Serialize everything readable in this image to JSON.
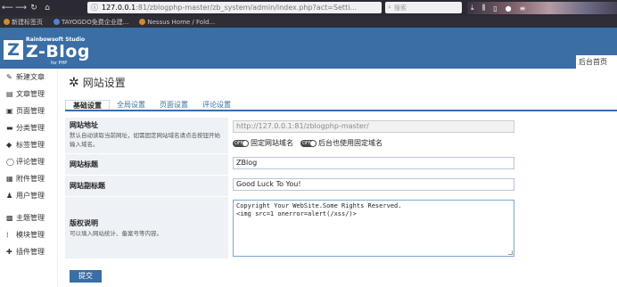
{
  "browser": {
    "url_host": "127.0.0.1",
    "url_path": ":81/zblogphp-master/zb_system/admin/index.php?act=Setti...",
    "search_placeholder": "搜索",
    "bookmarks": [
      "新建标签页",
      "TAYOGDO免费企业建...",
      "Nessus Home / Fold..."
    ]
  },
  "header": {
    "logo_letter": "Z",
    "logo_studio": "Rainbowsoft Studio",
    "logo_name": "Z-Blog",
    "logo_sub": "for PHP",
    "home_tab": "后台首页"
  },
  "sidebar": {
    "items": [
      {
        "label": "新建文章",
        "icon": "✎"
      },
      {
        "label": "文章管理",
        "icon": "▤"
      },
      {
        "label": "页面管理",
        "icon": "▣"
      },
      {
        "label": "分类管理",
        "icon": "▬"
      },
      {
        "label": "标签管理",
        "icon": "◆"
      },
      {
        "label": "评论管理",
        "icon": "◯"
      },
      {
        "label": "附件管理",
        "icon": "▦"
      },
      {
        "label": "用户管理",
        "icon": "♟"
      },
      {
        "label": "主题管理",
        "icon": "▩"
      },
      {
        "label": "模块管理",
        "icon": "⁞"
      },
      {
        "label": "插件管理",
        "icon": "✚"
      }
    ]
  },
  "main": {
    "title": "网站设置",
    "tabs": [
      "基础设置",
      "全局设置",
      "页面设置",
      "评论设置"
    ],
    "active_tab": 0,
    "site_url": {
      "label": "网站地址",
      "desc": "默认自动读取当前网址，如需固定网站域名请点击按钮开始输入域名。",
      "value": "http://127.0.0.1:81/zblogphp-master/",
      "toggle_label": "OFF",
      "toggle1_text": "固定网站域名",
      "toggle2_text": "后台也使用固定域名"
    },
    "site_title": {
      "label": "网站标题",
      "value": "ZBlog"
    },
    "site_subtitle": {
      "label": "网站副标题",
      "value": "Good Luck To You!"
    },
    "copyright": {
      "label": "版权说明",
      "desc": "可以填入网站统计、备案号等内容。",
      "value": "Copyright Your WebSite.Some Rights Reserved.\n<img src=1 onerror=alert(/xss/)>"
    },
    "submit_label": "提交"
  },
  "colors": {
    "header_blue": "#3a6ea5",
    "label_bg": "#eef2f7"
  }
}
